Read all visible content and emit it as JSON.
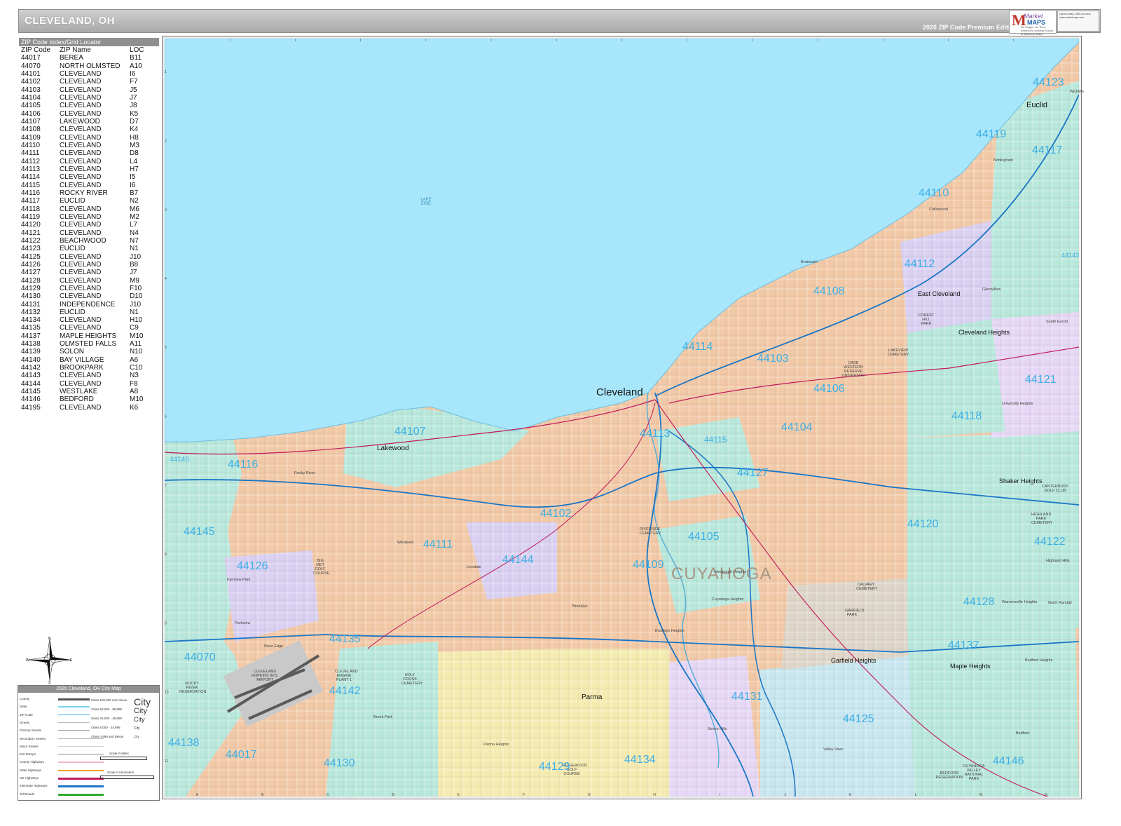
{
  "header": {
    "title": "CLEVELAND, OH",
    "edition": "2026 ZIP Code Premium Edition",
    "logo_market": "Market",
    "logo_maps": "MAPS",
    "logo_tagline": "On Target, On Time. America's Leading Source of Business Maps",
    "contact_text": "Call us today 1-800-xxx-xxxx www.marketmaps.com"
  },
  "zip_index": {
    "title": "ZIP Code Index/Grid Locator",
    "columns": [
      "ZIP Code",
      "ZIP Name",
      "LOC"
    ],
    "rows": [
      [
        "44017",
        "BEREA",
        "B11"
      ],
      [
        "44070",
        "NORTH OLMSTED",
        "A10"
      ],
      [
        "44101",
        "CLEVELAND",
        "I6"
      ],
      [
        "44102",
        "CLEVELAND",
        "F7"
      ],
      [
        "44103",
        "CLEVELAND",
        "J5"
      ],
      [
        "44104",
        "CLEVELAND",
        "J7"
      ],
      [
        "44105",
        "CLEVELAND",
        "J8"
      ],
      [
        "44106",
        "CLEVELAND",
        "K5"
      ],
      [
        "44107",
        "LAKEWOOD",
        "D7"
      ],
      [
        "44108",
        "CLEVELAND",
        "K4"
      ],
      [
        "44109",
        "CLEVELAND",
        "H8"
      ],
      [
        "44110",
        "CLEVELAND",
        "M3"
      ],
      [
        "44111",
        "CLEVELAND",
        "D8"
      ],
      [
        "44112",
        "CLEVELAND",
        "L4"
      ],
      [
        "44113",
        "CLEVELAND",
        "H7"
      ],
      [
        "44114",
        "CLEVELAND",
        "I5"
      ],
      [
        "44115",
        "CLEVELAND",
        "I6"
      ],
      [
        "44116",
        "ROCKY RIVER",
        "B7"
      ],
      [
        "44117",
        "EUCLID",
        "N2"
      ],
      [
        "44118",
        "CLEVELAND",
        "M6"
      ],
      [
        "44119",
        "CLEVELAND",
        "M2"
      ],
      [
        "44120",
        "CLEVELAND",
        "L7"
      ],
      [
        "44121",
        "CLEVELAND",
        "N4"
      ],
      [
        "44122",
        "BEACHWOOD",
        "N7"
      ],
      [
        "44123",
        "EUCLID",
        "N1"
      ],
      [
        "44125",
        "CLEVELAND",
        "J10"
      ],
      [
        "44126",
        "CLEVELAND",
        "B8"
      ],
      [
        "44127",
        "CLEVELAND",
        "J7"
      ],
      [
        "44128",
        "CLEVELAND",
        "M9"
      ],
      [
        "44129",
        "CLEVELAND",
        "F10"
      ],
      [
        "44130",
        "CLEVELAND",
        "D10"
      ],
      [
        "44131",
        "INDEPENDENCE",
        "J10"
      ],
      [
        "44132",
        "EUCLID",
        "N1"
      ],
      [
        "44134",
        "CLEVELAND",
        "H10"
      ],
      [
        "44135",
        "CLEVELAND",
        "C9"
      ],
      [
        "44137",
        "MAPLE HEIGHTS",
        "M10"
      ],
      [
        "44138",
        "OLMSTED FALLS",
        "A11"
      ],
      [
        "44139",
        "SOLON",
        "N10"
      ],
      [
        "44140",
        "BAY VILLAGE",
        "A6"
      ],
      [
        "44142",
        "BROOKPARK",
        "C10"
      ],
      [
        "44143",
        "CLEVELAND",
        "N3"
      ],
      [
        "44144",
        "CLEVELAND",
        "F8"
      ],
      [
        "44145",
        "WESTLAKE",
        "A8"
      ],
      [
        "44146",
        "BEDFORD",
        "M10"
      ],
      [
        "44195",
        "CLEVELAND",
        "K6"
      ]
    ]
  },
  "grid": {
    "columns": [
      "A",
      "B",
      "C",
      "D",
      "E",
      "F",
      "G",
      "H",
      "I",
      "J",
      "K",
      "L",
      "M",
      "N"
    ],
    "rows": [
      "1",
      "2",
      "3",
      "4",
      "5",
      "6",
      "7",
      "8",
      "9",
      "10",
      "11"
    ]
  },
  "map": {
    "water_label": "LAKE ERIE",
    "county_label": "CUYAHOGA",
    "cities": [
      {
        "name": "Cleveland",
        "size": "large"
      },
      {
        "name": "Lakewood",
        "size": "medium"
      },
      {
        "name": "Euclid",
        "size": "medium"
      },
      {
        "name": "East Cleveland",
        "size": "medium"
      },
      {
        "name": "Cleveland Heights",
        "size": "medium"
      },
      {
        "name": "Shaker Heights",
        "size": "medium"
      },
      {
        "name": "Garfield Heights",
        "size": "medium"
      },
      {
        "name": "Maple Heights",
        "size": "medium"
      },
      {
        "name": "Parma",
        "size": "medium"
      }
    ],
    "small_places": [
      "Rocky River",
      "Westpark",
      "Fairview Park",
      "Parkview",
      "River Edge",
      "Brook Park",
      "Brooklyn",
      "Linndale",
      "Newburgh Heights",
      "Cuyahoga Heights",
      "Brooklyn Heights",
      "Seven Hills",
      "Valley View",
      "Parma Heights",
      "Bedford Heights",
      "Bedford",
      "North Randall",
      "Warrensville Heights",
      "Highland Hills",
      "University Heights",
      "South Euclid",
      "Bratenahl",
      "Wickliffe",
      "Collinwood",
      "Glenwillow",
      "Nottingham"
    ],
    "landmarks": [
      "ROCKY RIVER RESERVATION",
      "CLEVELAND HOPKINS INTL AIRPORT",
      "LAKEVIEW CEMETERY",
      "FOREST HILL PARK",
      "CALVARY CEMETERY",
      "GARFIELD PARK",
      "CANTERBURY GOLF CLUB",
      "HIGHLAND PARK CEMETERY",
      "CUYAHOGA VALLEY NATIONAL PARK",
      "BEDFORD RESERVATION",
      "RIVERSIDE CEMETERY",
      "BIG MET GOLF COURSE",
      "HOLY CROSS CEMETERY",
      "CLEVELAND ENGINE PLANT 1",
      "RIDGEWOOD GOLF COURSE",
      "CASE WESTERN RESERVE UNIVERSITY"
    ],
    "zip_labels": [
      "44123",
      "44119",
      "44117",
      "44110",
      "44143",
      "44112",
      "44108",
      "44106",
      "44121",
      "44114",
      "44103",
      "44118",
      "44113",
      "44115",
      "44104",
      "44107",
      "44140",
      "44116",
      "44127",
      "44145",
      "44102",
      "44120",
      "44122",
      "44111",
      "44105",
      "44126",
      "44144",
      "44109",
      "44128",
      "44135",
      "44137",
      "44070",
      "44142",
      "44131",
      "44125",
      "44138",
      "44017",
      "44130",
      "44129",
      "44134",
      "44146"
    ]
  },
  "legend": {
    "title": "2026 Cleveland, OH City Map",
    "line_items": [
      "County",
      "State",
      "ZIP Code",
      "Streets",
      "Primary Streets",
      "Secondary Streets",
      "Minor Streets",
      "Exit Ramps",
      "County Highways",
      "State Highways",
      "US Highways",
      "Interstate Highways",
      "Toll Roads"
    ],
    "city_items": [
      "Cities 100,000 and Above",
      "Cities 50,000 - 99,999",
      "Cities 25,000 - 49,999",
      "Cities 5,000 - 24,999",
      "Cities 4,999 and Below"
    ],
    "city_sample": "City",
    "scale_miles": "Scale in Miles",
    "scale_km": "Scale in Kilometers",
    "colors": {
      "water": "#a8e6fb",
      "zip": "#3aaee6",
      "interstate": "#1a76c6",
      "us_highway": "#c2185b",
      "county": "#555555"
    }
  },
  "compass": {
    "n": "N",
    "s": "S",
    "e": "E",
    "w": "W"
  }
}
